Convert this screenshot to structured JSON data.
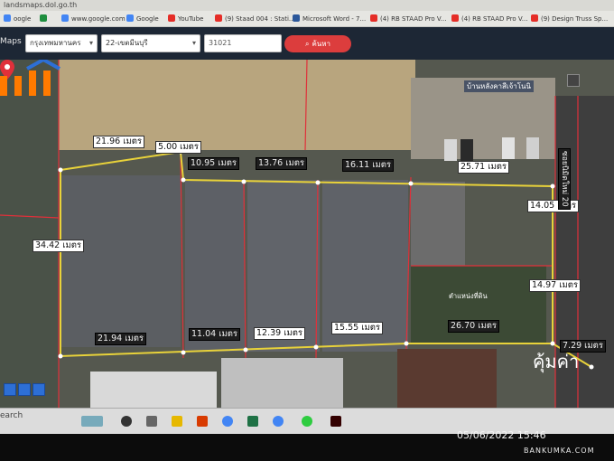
{
  "url": "landsmaps.dol.go.th",
  "bookmarks": [
    {
      "label": "oogle",
      "color": "#4285f4"
    },
    {
      "label": "",
      "color": "#1e8e3e"
    },
    {
      "label": "www.google.com",
      "color": "#4285f4"
    },
    {
      "label": "Google",
      "color": "#4285f4"
    },
    {
      "label": "YouTube",
      "color": "#e52d27"
    },
    {
      "label": "(9) Staad 004 : Stati...",
      "color": "#e52d27"
    },
    {
      "label": "Microsoft Word - 7...",
      "color": "#2b579a"
    },
    {
      "label": "(4) RB STAAD Pro V...",
      "color": "#e52d27"
    },
    {
      "label": "(4) RB STAAD Pro V...",
      "color": "#e52d27"
    },
    {
      "label": "(9) Design Truss Sp...",
      "color": "#e52d27"
    }
  ],
  "toolbar": {
    "logo": "Maps",
    "province": "กรุงเทพมหานคร",
    "district": "22-เขตมีนบุรี",
    "parcel_no": "31021",
    "search_label": "ค้นหา"
  },
  "map": {
    "info_label": "บ้านหลังคาสีเจ้าโนนิ",
    "poi_label": "ตำแหน่งที่ดิน",
    "road_label": "ซอยนิมิตใหม่ 20",
    "measurements": {
      "m1": "21.96 เมตร",
      "m2": "5.00 เมตร",
      "m3": "10.95 เมตร",
      "m4": "13.76 เมตร",
      "m5": "16.11 เมตร",
      "m6": "25.71 เมตร",
      "m7": "14.05 เมตร",
      "m8": "34.42 เมตร",
      "m9": "14.97 เมตร",
      "m10": "21.94 เมตร",
      "m11": "11.04 เมตร",
      "m12": "12.39 เมตร",
      "m13": "15.55 เมตร",
      "m14": "26.70 เมตร",
      "m15": "7.29 เมตร"
    }
  },
  "watermark": {
    "brand_thai": "คุ้มค่า",
    "brand_en": "BANKUMKA.COM"
  },
  "taskbar": {
    "search": "earch"
  },
  "timestamp": "05/06/2022 15:46",
  "colors": {
    "boundary": "#e8d23a",
    "parcel_line": "#e0303a",
    "accent": "#dc3d3d"
  }
}
